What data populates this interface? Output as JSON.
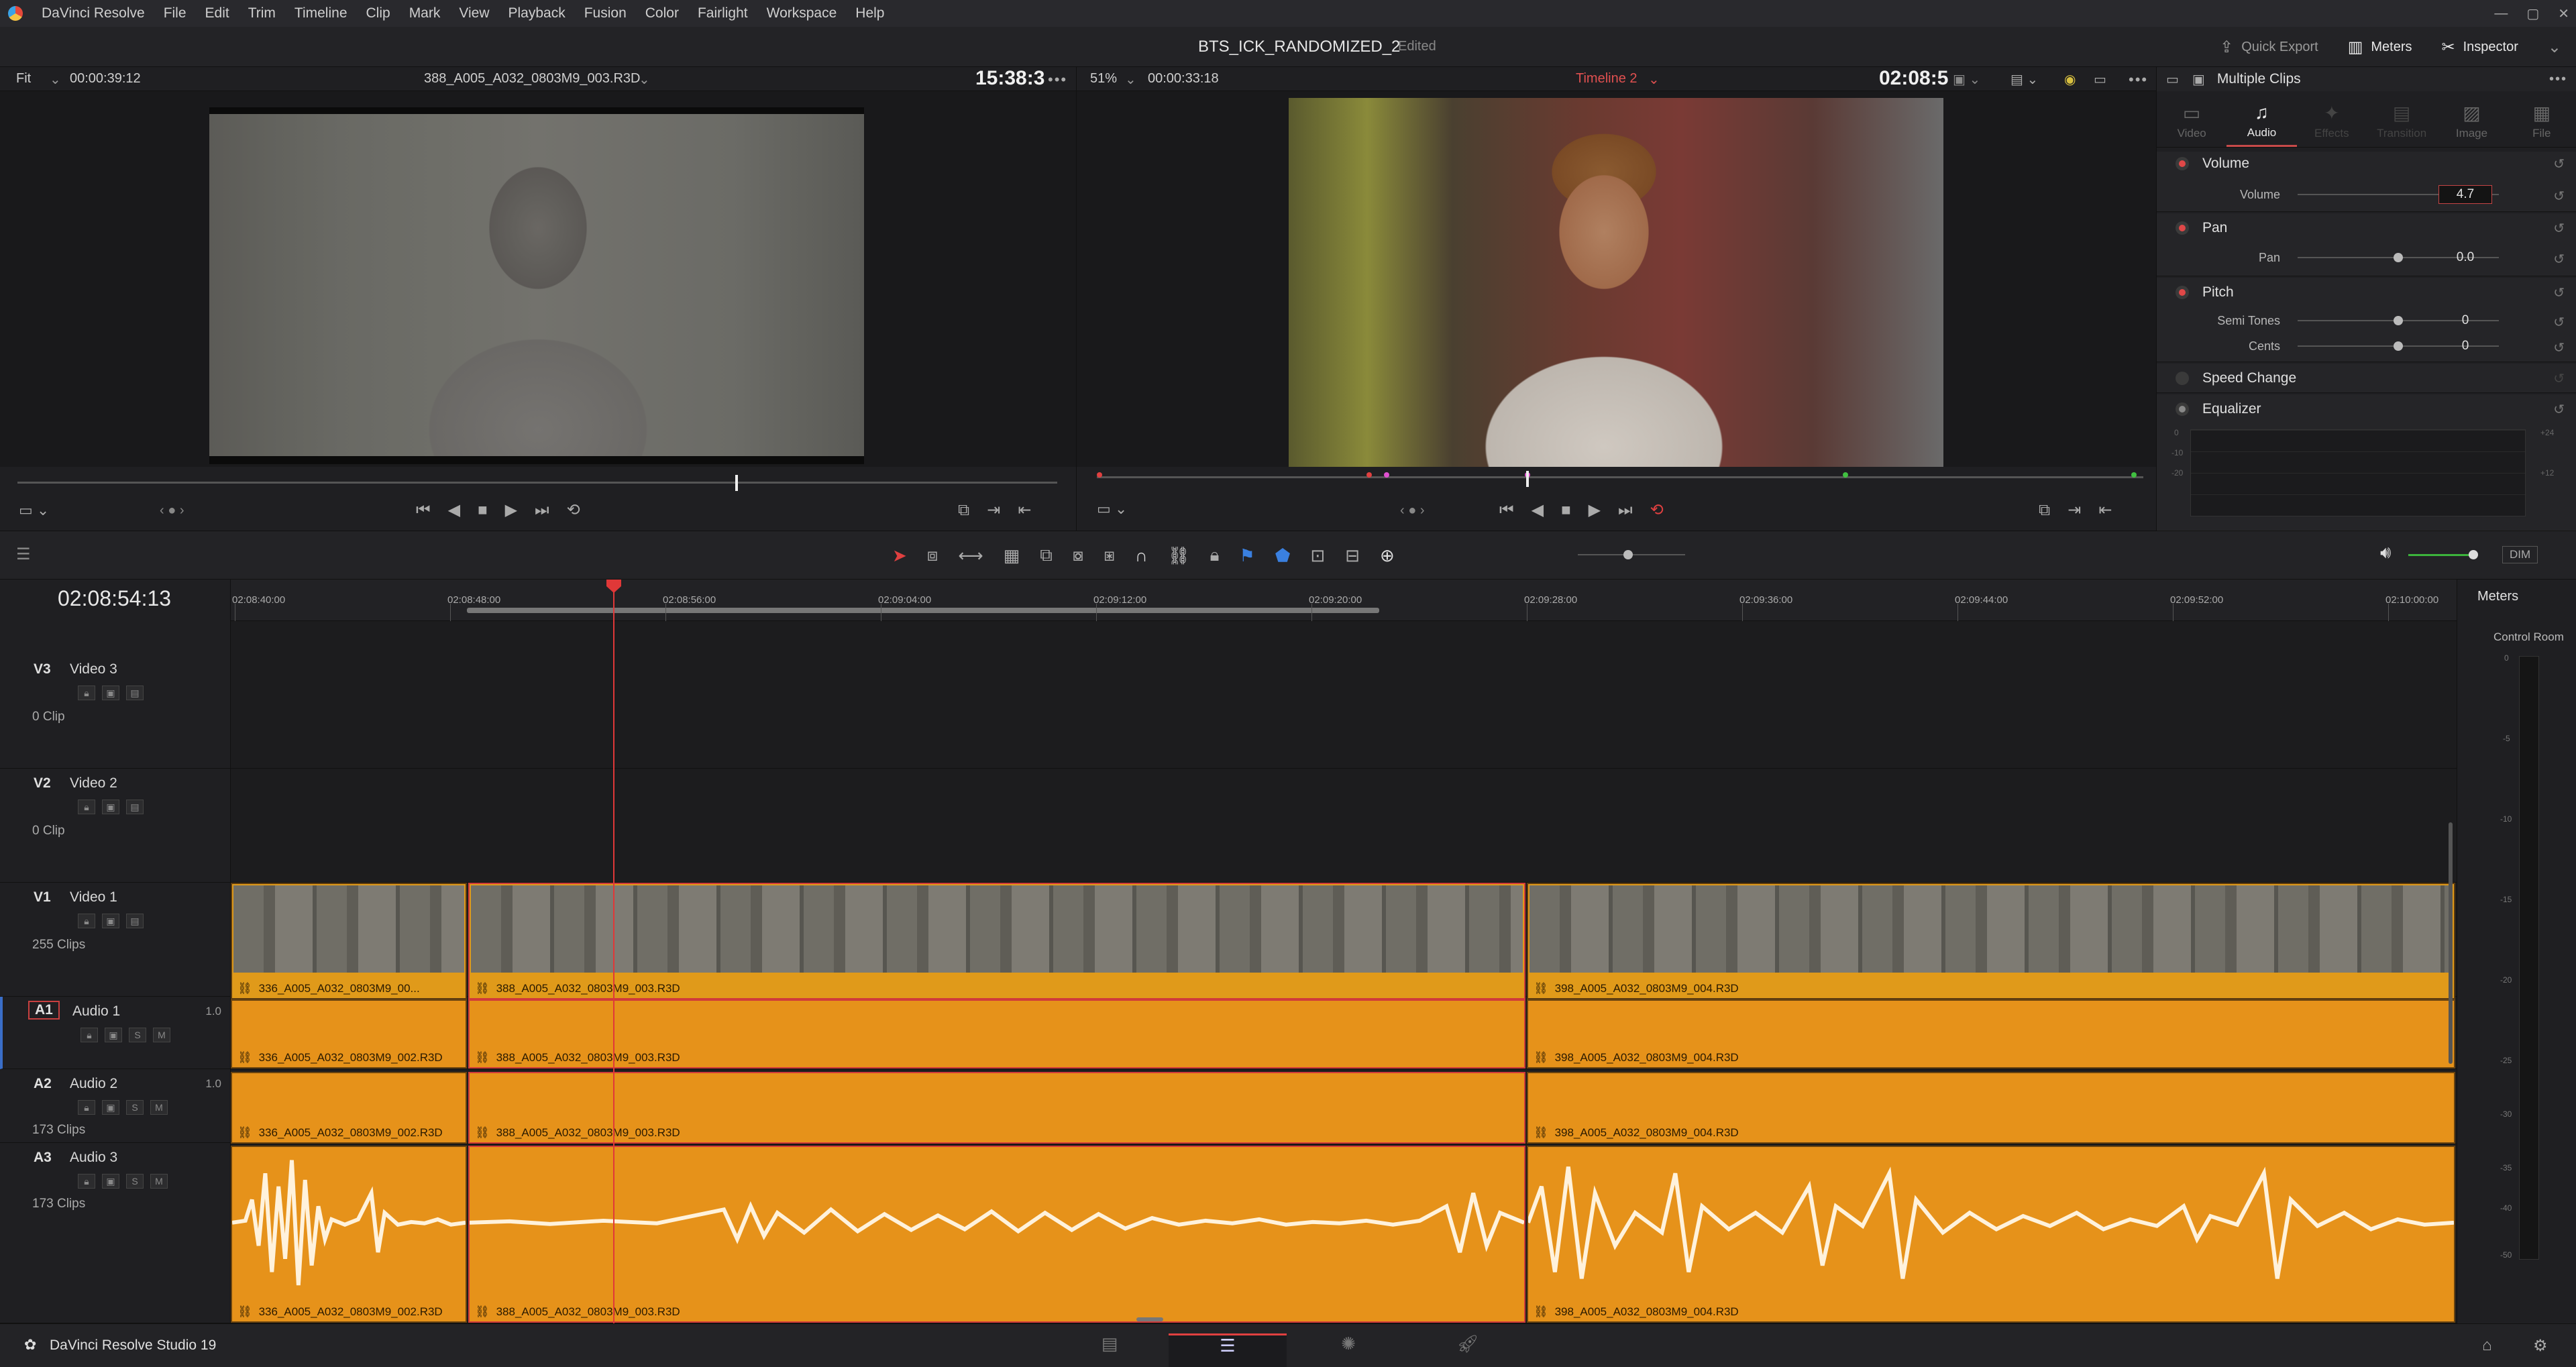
{
  "menubar": {
    "app_name": "DaVinci Resolve",
    "items": [
      "File",
      "Edit",
      "Trim",
      "Timeline",
      "Clip",
      "Mark",
      "View",
      "Playback",
      "Fusion",
      "Color",
      "Fairlight",
      "Workspace",
      "Help"
    ],
    "window_controls": [
      "—",
      "▢",
      "✕"
    ]
  },
  "titlebar": {
    "project": "BTS_ICK_RANDOMIZED_2",
    "status": "Edited",
    "quick_export": "Quick Export",
    "meters": "Meters",
    "inspector": "Inspector"
  },
  "source_viewer": {
    "zoom": "Fit",
    "timecode": "00:00:39:12",
    "clip_name": "388_A005_A032_0803M9_003.R3D",
    "big_timecode": "15:38:3",
    "playhead_fraction": 0.69
  },
  "record_viewer": {
    "zoom": "51%",
    "timecode": "00:00:33:18",
    "timeline_name": "Timeline 2",
    "big_timecode": "02:08:5",
    "playhead_fraction": 0.41
  },
  "inspector": {
    "title": "Multiple Clips",
    "tabs": [
      {
        "label": "Video",
        "icon": "▭",
        "active": false
      },
      {
        "label": "Audio",
        "icon": "♫",
        "active": true
      },
      {
        "label": "Effects",
        "icon": "✦",
        "active": false
      },
      {
        "label": "Transition",
        "icon": "▤",
        "active": false
      },
      {
        "label": "Image",
        "icon": "▨",
        "active": false
      },
      {
        "label": "File",
        "icon": "▦",
        "active": false
      }
    ],
    "volume": {
      "title": "Volume",
      "label": "Volume",
      "value": "4.7",
      "level": 0.83
    },
    "pan": {
      "title": "Pan",
      "label": "Pan",
      "value": "0.0",
      "level": 0.5
    },
    "pitch": {
      "title": "Pitch",
      "semitones_label": "Semi Tones",
      "semitones_value": "0",
      "cents_label": "Cents",
      "cents_value": "0",
      "level": 0.5
    },
    "speed_change": "Speed Change",
    "equalizer": "Equalizer",
    "eq_left_ticks": [
      "0",
      "-10",
      "-20"
    ],
    "eq_right_ticks": [
      "+24",
      "+12"
    ]
  },
  "timeline": {
    "current_timecode": "02:08:54:13",
    "ruler": [
      "02:08:40:00",
      "02:08:48:00",
      "02:08:56:00",
      "02:09:04:00",
      "02:09:12:00",
      "02:09:20:00",
      "02:09:28:00",
      "02:09:36:00",
      "02:09:44:00",
      "02:09:52:00",
      "02:10:00:00"
    ],
    "tracks": {
      "v3": {
        "id": "V3",
        "name": "Video 3",
        "clips": "0 Clip"
      },
      "v2": {
        "id": "V2",
        "name": "Video 2",
        "clips": "0 Clip"
      },
      "v1": {
        "id": "V1",
        "name": "Video 1",
        "clips": "255 Clips"
      },
      "a1": {
        "id": "A1",
        "name": "Audio 1",
        "gain": "1.0"
      },
      "a2": {
        "id": "A2",
        "name": "Audio 2",
        "gain": "1.0",
        "clips": "173 Clips"
      },
      "a3": {
        "id": "A3",
        "name": "Audio 3",
        "clips": "173 Clips"
      }
    },
    "clips": {
      "v1_c1": "336_A005_A032_0803M9_00...",
      "v1_c2": "388_A005_A032_0803M9_003.R3D",
      "v1_c3": "398_A005_A032_0803M9_004.R3D",
      "a_c1": "336_A005_A032_0803M9_002.R3D",
      "a_c2": "388_A005_A032_0803M9_003.R3D",
      "a_c3": "398_A005_A032_0803M9_004.R3D"
    },
    "dim": "DIM"
  },
  "meters": {
    "title": "Meters",
    "room": "Control Room",
    "ticks": [
      "0",
      "-5",
      "-10",
      "-15",
      "-20",
      "-25",
      "-30",
      "-35",
      "-40",
      "-50"
    ]
  },
  "pagebar": {
    "brand": "DaVinci Resolve Studio 19"
  }
}
